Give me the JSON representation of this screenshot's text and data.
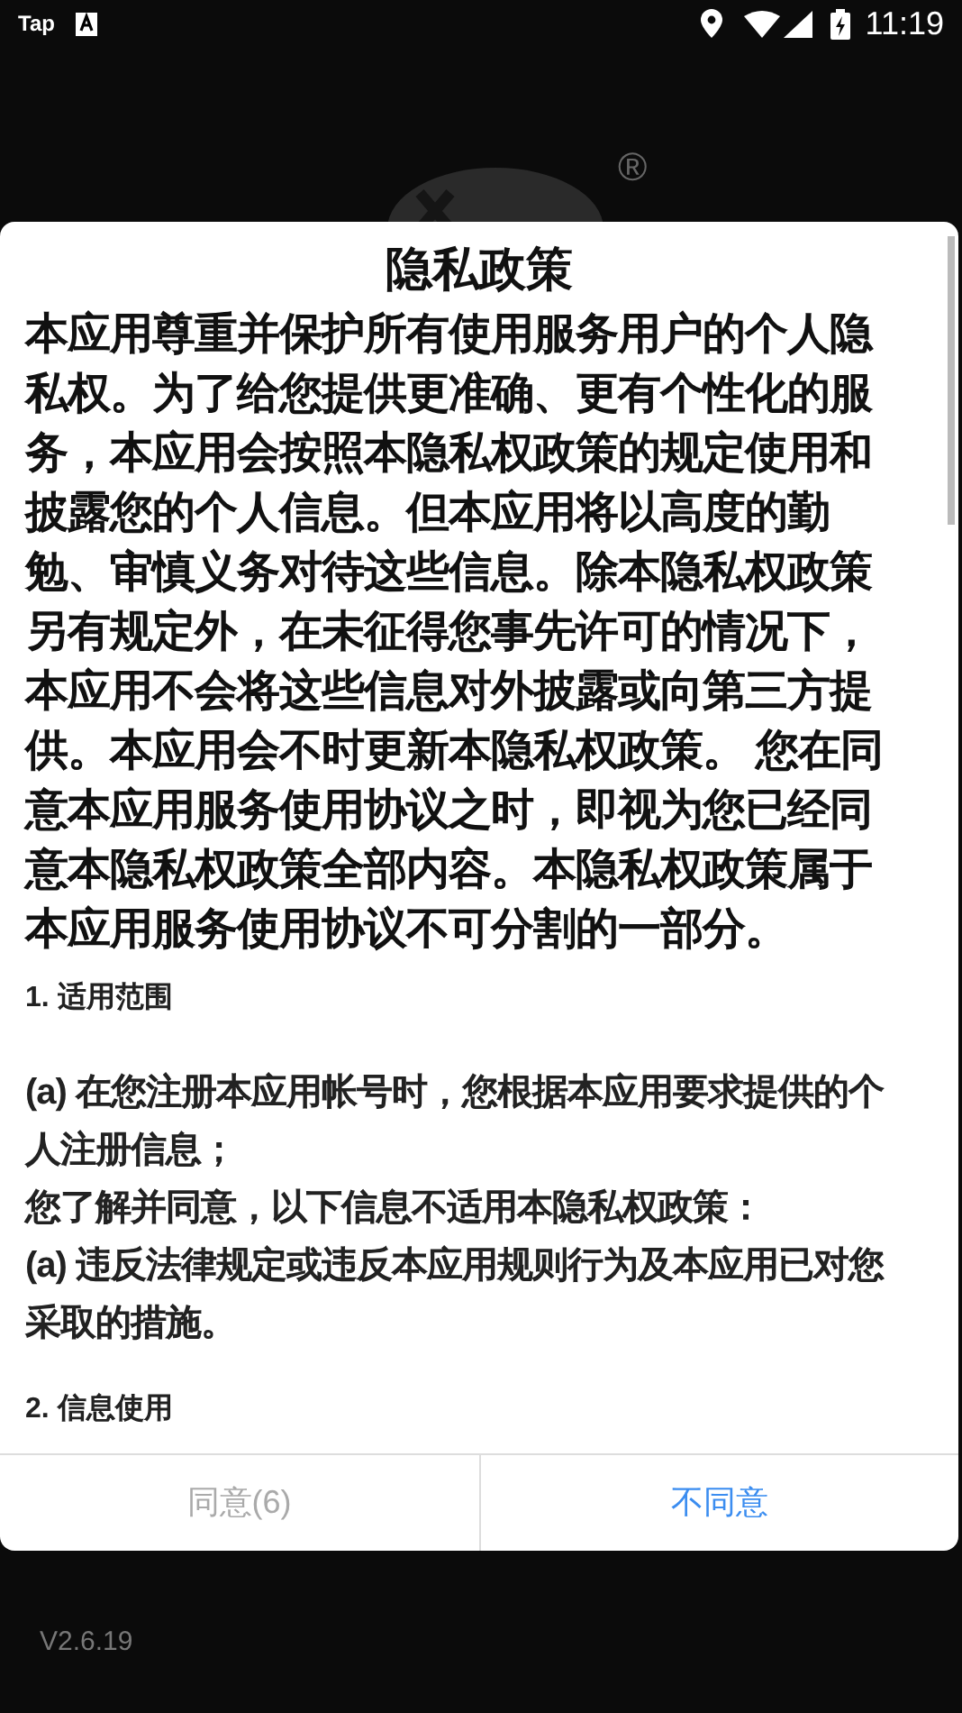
{
  "status_bar": {
    "app_label": "Tap",
    "time": "11:19"
  },
  "background": {
    "registered_mark": "®",
    "version": "V2.6.19"
  },
  "dialog": {
    "title": "隐私政策",
    "paragraphs": [
      {
        "kind": "intro",
        "text": "本应用尊重并保护所有使用服务用户的个人隐私权。为了给您提供更准确、更有个性化的服务，本应用会按照本隐私权政策的规定使用和披露您的个人信息。但本应用将以高度的勤勉、审慎义务对待这些信息。除本隐私权政策另有规定外，在未征得您事先许可的情况下，本应用不会将这些信息对外披露或向第三方提供。本应用会不时更新本隐私权政策。 您在同意本应用服务使用协议之时，即视为您已经同意本隐私权政策全部内容。本隐私权政策属于本应用服务使用协议不可分割的一部分。"
      },
      {
        "kind": "heading",
        "text": "1. 适用范围"
      },
      {
        "kind": "body",
        "text": "(a) 在您注册本应用帐号时，您根据本应用要求提供的个人注册信息；"
      },
      {
        "kind": "body",
        "text": "您了解并同意，以下信息不适用本隐私权政策："
      },
      {
        "kind": "body",
        "text": "(a) 违反法律规定或违反本应用规则行为及本应用已对您采取的措施。"
      },
      {
        "kind": "heading",
        "text": "2. 信息使用"
      }
    ],
    "buttons": [
      {
        "label": "同意(6)",
        "disabled": true
      },
      {
        "label": "不同意",
        "disabled": false
      }
    ]
  }
}
